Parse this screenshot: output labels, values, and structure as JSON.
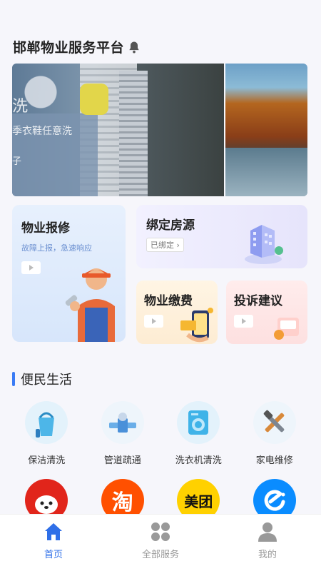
{
  "header": {
    "title": "邯郸物业服务平台",
    "bell_icon": "bell-icon"
  },
  "banner": {
    "text_line1": "洗",
    "text_line2": "季衣鞋任意洗",
    "text_line3": "子"
  },
  "cards": {
    "repair": {
      "title": "物业报修",
      "subtitle": "故障上报，急速响应"
    },
    "bind": {
      "title": "绑定房源",
      "tag": "已绑定"
    },
    "pay": {
      "title": "物业缴费"
    },
    "complain": {
      "title": "投诉建议"
    }
  },
  "section": {
    "title": "便民生活"
  },
  "services_row1": [
    {
      "label": "保洁清洗",
      "icon": "cleaning-bucket-icon"
    },
    {
      "label": "管道疏通",
      "icon": "pipe-icon"
    },
    {
      "label": "洗衣机清洗",
      "icon": "washing-machine-icon"
    },
    {
      "label": "家电维修",
      "icon": "tools-icon"
    }
  ],
  "services_row2": [
    {
      "brand": "京东",
      "icon": "jd-icon",
      "color": "#e1251b"
    },
    {
      "brand": "淘",
      "icon": "taobao-icon",
      "color": "#ff5000"
    },
    {
      "brand": "美团",
      "icon": "meituan-icon",
      "color": "#ffd100"
    },
    {
      "brand": "饿了么",
      "icon": "eleme-icon",
      "color": "#0a8cff"
    }
  ],
  "tabs": [
    {
      "label": "首页",
      "icon": "home-icon",
      "active": true
    },
    {
      "label": "全部服务",
      "icon": "grid-icon",
      "active": false
    },
    {
      "label": "我的",
      "icon": "user-icon",
      "active": false
    }
  ],
  "colors": {
    "accent": "#2f6fe8",
    "section_bar": "#3a7bf5"
  }
}
